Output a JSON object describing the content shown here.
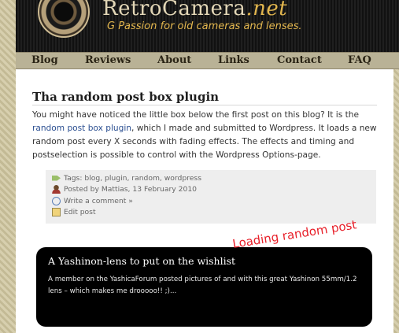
{
  "site": {
    "name": "RetroCamera",
    "tld": ".net",
    "tagline": "G Passion for old cameras and lenses."
  },
  "nav": {
    "items": [
      "Blog",
      "Reviews",
      "About",
      "Links",
      "Contact",
      "FAQ"
    ]
  },
  "post": {
    "title": "Tha random post box plugin",
    "body_before_link": "You might have noticed the little box below the first post on this blog? It is the ",
    "link_text": "random post box plugin",
    "body_after_link": ", which I made and submitted to Wordpress. It loads a new random post every X seconds with fading effects. The effects and timing and postselection is possible to control with the Wordpress Options-page.",
    "meta": {
      "tags_label": "Tags:",
      "tags": "blog, plugin, random, wordpress",
      "posted_by": "Posted by Mattias, 13 February 2010",
      "comment_link": "Write a comment »",
      "edit_link": "Edit post"
    }
  },
  "random_box": {
    "title": "A Yashinon-lens to put on the wishlist",
    "text": "A member on the YashicaForum posted pictures of and with this great Yashinon 55mm/1.2 lens – which makes me drooooo!! ;)...",
    "loading_label": "Loading random post"
  },
  "colors": {
    "accent_gold": "#e2b64e",
    "link_blue": "#2b4f91",
    "loading_red": "#e8202a"
  }
}
